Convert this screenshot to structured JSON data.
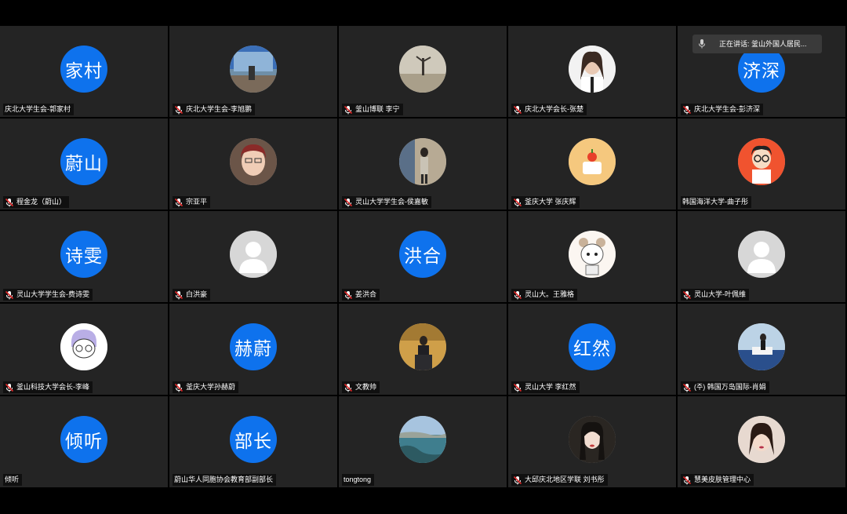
{
  "speaking_indicator": {
    "icon": "microphone-icon",
    "text": "正在讲话: 釜山外国人居民..."
  },
  "colors": {
    "tile_bg": "#242424",
    "avatar_blue": "#0e72ed",
    "muted_mic_red": "#e02828"
  },
  "participants": [
    {
      "name": "庆北大学生会-郭家村",
      "avatar_text": "家村",
      "avatar_type": "text",
      "muted": false
    },
    {
      "name": "庆北大学生会-李旭鹏",
      "avatar_type": "photo",
      "photo": "glass-building-photo",
      "muted": true
    },
    {
      "name": "釜山博联 李宁",
      "avatar_type": "photo",
      "photo": "beach-silhouette-photo",
      "muted": true
    },
    {
      "name": "庆北大学会长-张楚",
      "avatar_type": "photo",
      "photo": "woman-portrait-photo",
      "muted": true
    },
    {
      "name": "庆北大学生会-彭济深",
      "avatar_text": "济深",
      "avatar_type": "text",
      "muted": true
    },
    {
      "name": "程金龙（蔚山）",
      "avatar_text": "蔚山",
      "avatar_type": "text",
      "muted": true
    },
    {
      "name": "宗亚平",
      "avatar_type": "photo",
      "photo": "woman-glasses-photo",
      "muted": true
    },
    {
      "name": "灵山大学学生会-侯嘉敏",
      "avatar_type": "photo",
      "photo": "person-standing-photo",
      "muted": true
    },
    {
      "name": "釜庆大学 张庆辉",
      "avatar_type": "photo",
      "photo": "cake-illustration",
      "muted": true
    },
    {
      "name": "韩国海洋大学-曲子彤",
      "avatar_type": "photo",
      "photo": "cartoon-boy-glasses",
      "muted": false
    },
    {
      "name": "灵山大学学生会-费诗雯",
      "avatar_text": "诗雯",
      "avatar_type": "text",
      "muted": true
    },
    {
      "name": "白洪豪",
      "avatar_type": "default",
      "photo": "default-person-icon",
      "muted": true
    },
    {
      "name": "姜洪合",
      "avatar_text": "洪合",
      "avatar_type": "text",
      "muted": true
    },
    {
      "name": "灵山大。王雅格",
      "avatar_type": "photo",
      "photo": "cartoon-girl-illustration",
      "muted": true
    },
    {
      "name": "灵山大学-叶佩维",
      "avatar_type": "default",
      "photo": "default-person-icon",
      "muted": true
    },
    {
      "name": "釜山科技大学会长-李峰",
      "avatar_type": "photo",
      "photo": "cartoon-glasses-doodle",
      "muted": true
    },
    {
      "name": "釜庆大学孙赫蔚",
      "avatar_text": "赫蔚",
      "avatar_type": "text",
      "muted": true
    },
    {
      "name": "文教帅",
      "avatar_type": "photo",
      "photo": "speaker-podium-photo",
      "muted": true
    },
    {
      "name": "灵山大学 李红然",
      "avatar_text": "红然",
      "avatar_type": "text",
      "muted": true
    },
    {
      "name": "(주) 韩国万岛国际-肖娟",
      "avatar_type": "photo",
      "photo": "boat-sea-photo",
      "muted": true
    },
    {
      "name": "倾听",
      "avatar_text": "倾听",
      "avatar_type": "text",
      "muted": false
    },
    {
      "name": "蔚山华人同胞协会教育部副部长",
      "avatar_text": "部长",
      "avatar_type": "text",
      "muted": false
    },
    {
      "name": "tongtong",
      "avatar_type": "photo",
      "photo": "coastline-photo",
      "muted": false
    },
    {
      "name": "大邱庆北地区学联 刘书彤",
      "avatar_type": "photo",
      "photo": "woman-dark-hair-photo",
      "muted": true
    },
    {
      "name": "慧美皮肤管理中心",
      "avatar_type": "photo",
      "photo": "woman-selfie-photo",
      "muted": true
    }
  ]
}
